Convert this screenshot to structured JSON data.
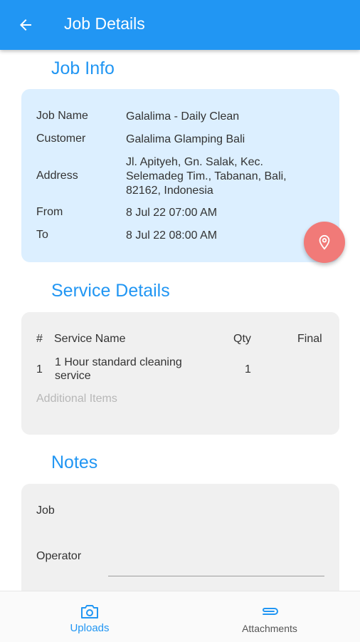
{
  "appbar": {
    "title": "Job Details",
    "back_icon": "arrow-left-icon"
  },
  "job_info": {
    "title": "Job Info",
    "rows": [
      {
        "label": "Job Name",
        "value": "Galalima - Daily Clean"
      },
      {
        "label": "Customer",
        "value": "Galalima Glamping Bali"
      },
      {
        "label": "Address",
        "value": "Jl. Apityeh, Gn. Salak, Kec. Selemadeg Tim., Tabanan, Bali, 82162, Indonesia"
      },
      {
        "label": "From",
        "value": "8 Jul 22 07:00 AM"
      },
      {
        "label": "To",
        "value": "8 Jul 22 08:00 AM"
      }
    ],
    "fab_icon": "map-pin-icon"
  },
  "service_details": {
    "title": "Service Details",
    "columns": [
      "#",
      "Service Name",
      "Qty",
      "Final"
    ],
    "rows": [
      {
        "num": "1",
        "name": "1 Hour standard cleaning service",
        "qty": "1",
        "final": ""
      }
    ],
    "additional": "Additional Items"
  },
  "notes": {
    "title": "Notes",
    "job_label": "Job",
    "operator_label": "Operator"
  },
  "bottom_nav": {
    "uploads": {
      "label": "Uploads",
      "icon": "camera-icon"
    },
    "attachments": {
      "label": "Attachments",
      "icon": "paperclip-icon"
    }
  },
  "colors": {
    "primary": "#2196f3",
    "fab": "#f17a78",
    "info_card": "#dcefff",
    "gray_card": "#f0f0f0"
  }
}
